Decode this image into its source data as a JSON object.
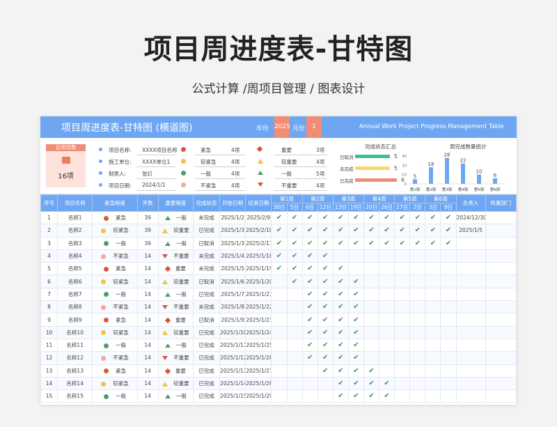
{
  "page": {
    "title": "项目周进度表-甘特图",
    "subtitle": "公式计算 /周项目管理 / 图表设计"
  },
  "banner": {
    "title": "项目周进度表-甘特图 (横道图)",
    "year_label": "年份",
    "year_value": "2025",
    "month_label": "月份",
    "month_value": "1",
    "english_title": "Annual Work Project Progress Management Table"
  },
  "summary": {
    "total_label": "总项目数",
    "total_value": "16项",
    "project_fields": [
      {
        "label": "项目名称:",
        "value": "XXXX项目名称"
      },
      {
        "label": "施工单位:",
        "value": "XXXX单位1"
      },
      {
        "label": "制表人:",
        "value": "张灯"
      },
      {
        "label": "项目日期:",
        "value": "2024/1/1"
      }
    ],
    "urgency_counts": [
      {
        "label": "紧急",
        "value": "4项",
        "color": "#d9573a"
      },
      {
        "label": "较紧急",
        "value": "4项",
        "color": "#f0c24a"
      },
      {
        "label": "一般",
        "value": "4项",
        "color": "#4d9a74"
      },
      {
        "label": "不紧急",
        "value": "4项",
        "color": "#f2a999"
      }
    ],
    "importance_counts": [
      {
        "label": "重要",
        "value": "3项"
      },
      {
        "label": "较重要",
        "value": "4项"
      },
      {
        "label": "一般",
        "value": "5项"
      },
      {
        "label": "不重要",
        "value": "4项"
      }
    ]
  },
  "status_chart": {
    "title": "完成状态汇总",
    "items": [
      {
        "label": "已取消",
        "value": 5,
        "color": "#3fc08a"
      },
      {
        "label": "未完成",
        "value": 5,
        "color": "#f8d86a"
      },
      {
        "label": "已完成",
        "value": 6,
        "color": "#ef8d78"
      }
    ]
  },
  "chart_data": {
    "type": "bar",
    "title": "周完成数量统计",
    "categories": [
      "第1周",
      "第2周",
      "第3周",
      "第4周",
      "第5周",
      "第6周"
    ],
    "values": [
      5,
      18,
      28,
      22,
      10,
      6
    ],
    "color": "#6ea6f1"
  },
  "table": {
    "headers": {
      "index": "序号",
      "name": "项目名称",
      "urgency": "紧急程度",
      "days": "天数",
      "importance": "重要程度",
      "status": "完成状态",
      "start": "开始日期",
      "end": "结束日期",
      "owner": "负责人",
      "dept": "所属部门"
    },
    "weeks": [
      "第1周",
      "第2周",
      "第3周",
      "第4周",
      "第5周",
      "第6周"
    ],
    "days": [
      "30日",
      "5日",
      "6日",
      "12日",
      "13日",
      "19日",
      "20日",
      "26日",
      "27日",
      "2日",
      "3日",
      "9日"
    ],
    "rows": [
      {
        "idx": "1",
        "name": "名称1",
        "urgency": "紧急",
        "ucolor": "#d9573a",
        "days": "39",
        "imp": "一般",
        "shape": "tri-up",
        "status": "未完成",
        "start": "2025/1/2",
        "end": "2025/2/9",
        "checks": [
          1,
          1,
          1,
          1,
          1,
          1,
          1,
          1,
          1,
          1,
          1,
          1
        ],
        "owner": "2024/12/30"
      },
      {
        "idx": "2",
        "name": "名称2",
        "urgency": "较紧急",
        "ucolor": "#f0c24a",
        "days": "39",
        "imp": "较重要",
        "shape": "tri-up-y",
        "status": "已完成",
        "start": "2025/1/3",
        "end": "2025/2/10",
        "checks": [
          1,
          1,
          1,
          1,
          1,
          1,
          1,
          1,
          1,
          1,
          1,
          1
        ],
        "owner": "2025/1/5"
      },
      {
        "idx": "3",
        "name": "名称3",
        "urgency": "一般",
        "ucolor": "#4d9a74",
        "days": "39",
        "imp": "一般",
        "shape": "tri-up",
        "status": "已取消",
        "start": "2025/1/3",
        "end": "2025/2/11",
        "checks": [
          1,
          1,
          1,
          1,
          1,
          1,
          1,
          1,
          1,
          1,
          1,
          1
        ],
        "owner": ""
      },
      {
        "idx": "4",
        "name": "名称4",
        "urgency": "不紧急",
        "ucolor": "#f2a999",
        "days": "14",
        "imp": "不重要",
        "shape": "tri-down",
        "status": "未完成",
        "start": "2025/1/4",
        "end": "2025/1/18",
        "checks": [
          1,
          1,
          1,
          1,
          0,
          0,
          0,
          0,
          0,
          0,
          0,
          0
        ],
        "owner": ""
      },
      {
        "idx": "5",
        "name": "名称5",
        "urgency": "紧急",
        "ucolor": "#d9573a",
        "days": "14",
        "imp": "重要",
        "shape": "diamond",
        "status": "未完成",
        "start": "2025/1/5",
        "end": "2025/1/19",
        "checks": [
          1,
          1,
          1,
          1,
          1,
          0,
          0,
          0,
          0,
          0,
          0,
          0
        ],
        "owner": ""
      },
      {
        "idx": "6",
        "name": "名称6",
        "urgency": "较紧急",
        "ucolor": "#f0c24a",
        "days": "14",
        "imp": "较重要",
        "shape": "tri-up-y",
        "status": "已取消",
        "start": "2025/1/6",
        "end": "2025/1/20",
        "checks": [
          0,
          1,
          1,
          1,
          1,
          1,
          0,
          0,
          0,
          0,
          0,
          0
        ],
        "owner": ""
      },
      {
        "idx": "7",
        "name": "名称7",
        "urgency": "一般",
        "ucolor": "#4d9a74",
        "days": "14",
        "imp": "一般",
        "shape": "tri-up",
        "status": "已完成",
        "start": "2025/1/7",
        "end": "2025/1/21",
        "checks": [
          0,
          0,
          1,
          1,
          1,
          1,
          0,
          0,
          0,
          0,
          0,
          0
        ],
        "owner": ""
      },
      {
        "idx": "8",
        "name": "名称8",
        "urgency": "不紧急",
        "ucolor": "#f2a999",
        "days": "14",
        "imp": "不重要",
        "shape": "tri-down",
        "status": "未完成",
        "start": "2025/1/8",
        "end": "2025/1/22",
        "checks": [
          0,
          0,
          1,
          1,
          1,
          1,
          0,
          0,
          0,
          0,
          0,
          0
        ],
        "owner": ""
      },
      {
        "idx": "9",
        "name": "名称9",
        "urgency": "紧急",
        "ucolor": "#d9573a",
        "days": "14",
        "imp": "重要",
        "shape": "diamond",
        "status": "已取消",
        "start": "2025/1/9",
        "end": "2025/1/23",
        "checks": [
          0,
          0,
          1,
          1,
          1,
          1,
          0,
          0,
          0,
          0,
          0,
          0
        ],
        "owner": ""
      },
      {
        "idx": "10",
        "name": "名称10",
        "urgency": "较紧急",
        "ucolor": "#f0c24a",
        "days": "14",
        "imp": "较重要",
        "shape": "tri-up-y",
        "status": "已完成",
        "start": "2025/1/10",
        "end": "2025/1/24",
        "checks": [
          0,
          0,
          1,
          1,
          1,
          1,
          0,
          0,
          0,
          0,
          0,
          0
        ],
        "owner": ""
      },
      {
        "idx": "11",
        "name": "名称11",
        "urgency": "一般",
        "ucolor": "#4d9a74",
        "days": "14",
        "imp": "一般",
        "shape": "tri-up",
        "status": "已完成",
        "start": "2025/1/11",
        "end": "2025/1/25",
        "checks": [
          0,
          0,
          1,
          1,
          1,
          1,
          0,
          0,
          0,
          0,
          0,
          0
        ],
        "owner": ""
      },
      {
        "idx": "12",
        "name": "名称12",
        "urgency": "不紧急",
        "ucolor": "#f2a999",
        "days": "14",
        "imp": "不重要",
        "shape": "tri-down",
        "status": "已完成",
        "start": "2025/1/12",
        "end": "2025/1/26",
        "checks": [
          0,
          0,
          1,
          1,
          1,
          1,
          0,
          0,
          0,
          0,
          0,
          0
        ],
        "owner": ""
      },
      {
        "idx": "13",
        "name": "名称13",
        "urgency": "紧急",
        "ucolor": "#d9573a",
        "days": "14",
        "imp": "重要",
        "shape": "diamond",
        "status": "已完成",
        "start": "2025/1/13",
        "end": "2025/1/27",
        "checks": [
          0,
          0,
          0,
          1,
          1,
          1,
          1,
          0,
          0,
          0,
          0,
          0
        ],
        "owner": ""
      },
      {
        "idx": "14",
        "name": "名称14",
        "urgency": "较紧急",
        "ucolor": "#f0c24a",
        "days": "14",
        "imp": "较重要",
        "shape": "tri-up-y",
        "status": "已完成",
        "start": "2025/1/14",
        "end": "2025/1/28",
        "checks": [
          0,
          0,
          0,
          0,
          1,
          1,
          1,
          1,
          0,
          0,
          0,
          0
        ],
        "owner": ""
      },
      {
        "idx": "15",
        "name": "名称15",
        "urgency": "一般",
        "ucolor": "#4d9a74",
        "days": "14",
        "imp": "一般",
        "shape": "tri-up",
        "status": "已完成",
        "start": "2025/1/15",
        "end": "2025/1/29",
        "checks": [
          0,
          0,
          0,
          0,
          1,
          1,
          1,
          1,
          0,
          0,
          0,
          0
        ],
        "owner": ""
      }
    ]
  }
}
